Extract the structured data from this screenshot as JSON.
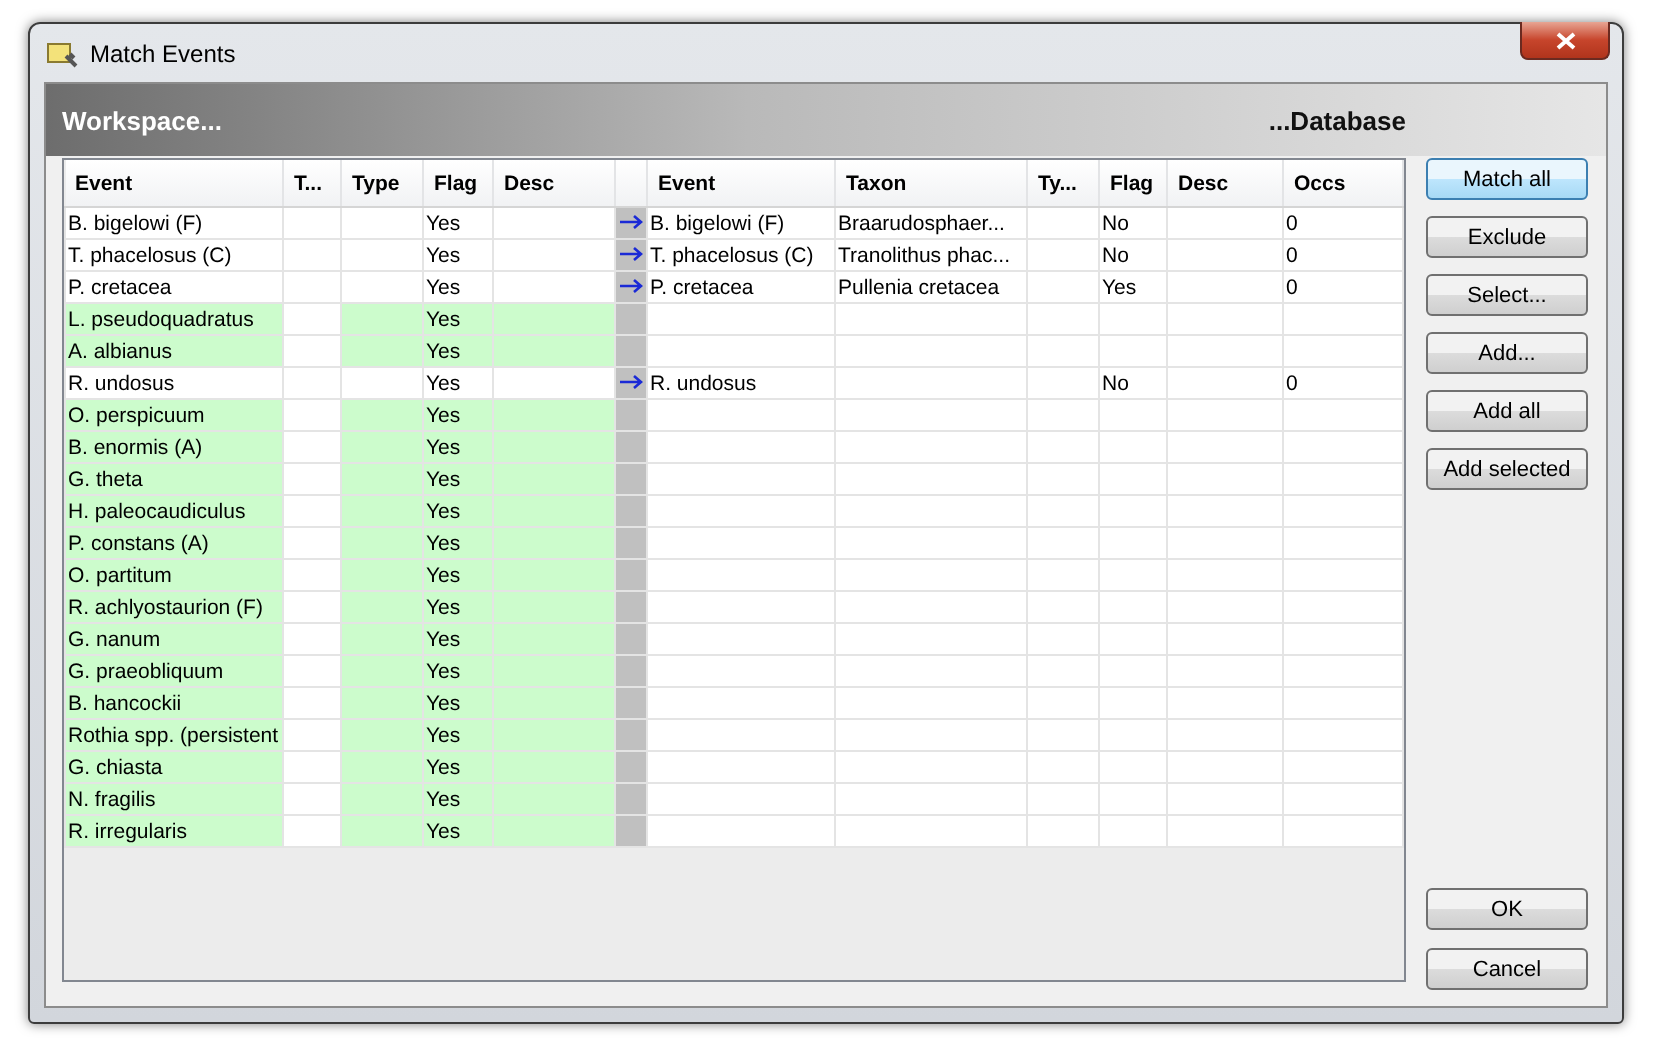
{
  "window": {
    "title": "Match Events"
  },
  "header": {
    "left": "Workspace...",
    "right": "...Database"
  },
  "workspace_columns": [
    "Event",
    "T...",
    "Type",
    "Flag",
    "Desc"
  ],
  "database_columns": [
    "Event",
    "Taxon",
    "Ty...",
    "Flag",
    "Desc",
    "Occs"
  ],
  "rows": [
    {
      "event": "B. bigelowi (F)",
      "flag": "Yes",
      "matched": true,
      "db": {
        "event": "B. bigelowi (F)",
        "taxon": "Braarudosphaer...",
        "flag": "No",
        "occs": "0"
      }
    },
    {
      "event": "T. phacelosus (C)",
      "flag": "Yes",
      "matched": true,
      "db": {
        "event": "T. phacelosus (C)",
        "taxon": "Tranolithus phac...",
        "flag": "No",
        "occs": "0"
      }
    },
    {
      "event": "P. cretacea",
      "flag": "Yes",
      "matched": true,
      "db": {
        "event": "P. cretacea",
        "taxon": "Pullenia cretacea",
        "flag": "Yes",
        "occs": "0"
      }
    },
    {
      "event": "L. pseudoquadratus",
      "flag": "Yes",
      "matched": false
    },
    {
      "event": "A. albianus",
      "flag": "Yes",
      "matched": false
    },
    {
      "event": "R. undosus",
      "flag": "Yes",
      "matched": true,
      "db": {
        "event": "R. undosus",
        "flag": "No",
        "occs": "0"
      }
    },
    {
      "event": "O. perspicuum",
      "flag": "Yes",
      "matched": false
    },
    {
      "event": "B. enormis (A)",
      "flag": "Yes",
      "matched": false
    },
    {
      "event": "G. theta",
      "flag": "Yes",
      "matched": false
    },
    {
      "event": "H. paleocaudiculus",
      "flag": "Yes",
      "matched": false
    },
    {
      "event": "P. constans (A)",
      "flag": "Yes",
      "matched": false
    },
    {
      "event": "O. partitum",
      "flag": "Yes",
      "matched": false
    },
    {
      "event": "R. achlyostaurion (F)",
      "flag": "Yes",
      "matched": false
    },
    {
      "event": "G. nanum",
      "flag": "Yes",
      "matched": false
    },
    {
      "event": "G. praeobliquum",
      "flag": "Yes",
      "matched": false
    },
    {
      "event": "B. hancockii",
      "flag": "Yes",
      "matched": false
    },
    {
      "event": "Rothia spp. (persistent",
      "flag": "Yes",
      "matched": false
    },
    {
      "event": "G. chiasta",
      "flag": "Yes",
      "matched": false
    },
    {
      "event": "N. fragilis",
      "flag": "Yes",
      "matched": false
    },
    {
      "event": "R. irregularis",
      "flag": "Yes",
      "matched": false
    }
  ],
  "side_buttons": [
    {
      "label": "Match all",
      "focused": true
    },
    {
      "label": "Exclude",
      "focused": false
    },
    {
      "label": "Select...",
      "focused": false
    },
    {
      "label": "Add...",
      "focused": false
    },
    {
      "label": "Add all",
      "focused": false
    },
    {
      "label": "Add selected",
      "focused": false
    }
  ],
  "dialog_buttons": [
    "OK",
    "Cancel"
  ]
}
